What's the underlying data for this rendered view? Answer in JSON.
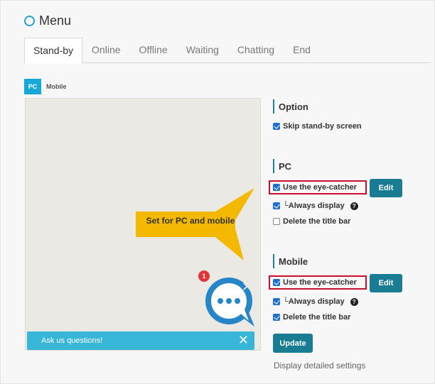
{
  "header": {
    "title": "Menu"
  },
  "tabs": [
    {
      "label": "Stand-by",
      "active": true
    },
    {
      "label": "Online",
      "active": false
    },
    {
      "label": "Offline",
      "active": false
    },
    {
      "label": "Waiting",
      "active": false
    },
    {
      "label": "Chatting",
      "active": false
    },
    {
      "label": "End",
      "active": false
    }
  ],
  "device": {
    "pc": "PC",
    "mobile": "Mobile"
  },
  "preview": {
    "callout": "Set for PC and mobile",
    "badge_count": "1",
    "bar_text": "Ask us questions!",
    "close_glyph": "✕",
    "chat_close_glyph": "✕"
  },
  "option_section": {
    "title": "Option",
    "skip_standby": {
      "label": "Skip stand-by screen",
      "checked": true
    }
  },
  "pc_section": {
    "title": "PC",
    "use_eye_catcher": {
      "label": "Use the eye-catcher",
      "checked": true
    },
    "always_display": {
      "label": "└Always display",
      "checked": true
    },
    "delete_title_bar": {
      "label": "Delete the title bar",
      "checked": false
    },
    "edit_label": "Edit"
  },
  "mobile_section": {
    "title": "Mobile",
    "use_eye_catcher": {
      "label": "Use the eye-catcher",
      "checked": true
    },
    "always_display": {
      "label": "└Always display",
      "checked": true
    },
    "delete_title_bar": {
      "label": "Delete the title bar",
      "checked": true
    },
    "edit_label": "Edit"
  },
  "update_label": "Update",
  "detail_link": "Display detailed settings",
  "help_glyph": "?",
  "colors": {
    "accent": "#1a7c92",
    "highlight": "#c8102e",
    "callout": "#f5b800",
    "bar": "#37b6d8"
  }
}
